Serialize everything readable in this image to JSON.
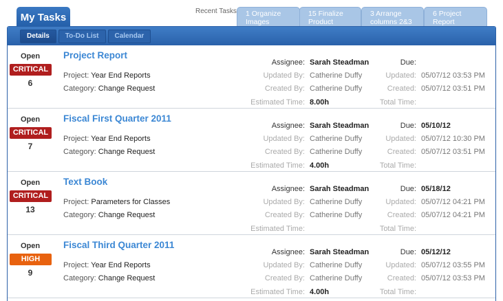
{
  "header": {
    "my_tasks_tab": "My Tasks",
    "recent_label": "Recent Tasks:",
    "recent_tabs": [
      "1 Organize Images",
      "15 Finalize Product",
      "3 Arrange columns 2&3",
      "6 Project Report"
    ]
  },
  "toolbar": {
    "buttons": [
      "Details",
      "To-Do List",
      "Calendar"
    ],
    "active": "Details"
  },
  "labels": {
    "project": "Project:",
    "category": "Category:",
    "assignee": "Assignee:",
    "updated_by": "Updated By:",
    "created_by": "Created By:",
    "estimated_time": "Estimated Time:",
    "due": "Due:",
    "updated": "Updated:",
    "created": "Created:",
    "total_time": "Total Time:"
  },
  "colors": {
    "critical": "#b01e1e",
    "high": "#e8620f",
    "link": "#3b87d4"
  },
  "tasks": [
    {
      "status": "Open",
      "priority": "CRITICAL",
      "number": "6",
      "title": "Project Report",
      "project": "Year End Reports",
      "category": "Change Request",
      "assignee": "Sarah Steadman",
      "updated_by": "Catherine Duffy",
      "created_by": "Catherine Duffy",
      "estimated_time": "8.00h",
      "due": "",
      "updated": "05/07/12 03:53 PM",
      "created": "05/07/12 03:51 PM",
      "total_time": ""
    },
    {
      "status": "Open",
      "priority": "CRITICAL",
      "number": "7",
      "title": "Fiscal First Quarter 2011",
      "project": "Year End Reports",
      "category": "Change Request",
      "assignee": "Sarah Steadman",
      "updated_by": "Catherine Duffy",
      "created_by": "Catherine Duffy",
      "estimated_time": "4.00h",
      "due": "05/10/12",
      "updated": "05/07/12 10:30 PM",
      "created": "05/07/12 03:51 PM",
      "total_time": ""
    },
    {
      "status": "Open",
      "priority": "CRITICAL",
      "number": "13",
      "title": "Text Book",
      "project": "Parameters for Classes",
      "category": "Change Request",
      "assignee": "Sarah Steadman",
      "updated_by": "Catherine Duffy",
      "created_by": "Catherine Duffy",
      "estimated_time": "",
      "due": "05/18/12",
      "updated": "05/07/12 04:21 PM",
      "created": "05/07/12 04:21 PM",
      "total_time": ""
    },
    {
      "status": "Open",
      "priority": "HIGH",
      "number": "9",
      "title": "Fiscal Third Quarter 2011",
      "project": "Year End Reports",
      "category": "Change Request",
      "assignee": "Sarah Steadman",
      "updated_by": "Catherine Duffy",
      "created_by": "Catherine Duffy",
      "estimated_time": "4.00h",
      "due": "05/12/12",
      "updated": "05/07/12 03:55 PM",
      "created": "05/07/12 03:53 PM",
      "total_time": ""
    }
  ]
}
